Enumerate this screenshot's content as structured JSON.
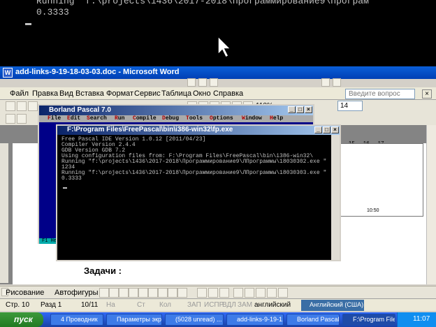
{
  "background_console": {
    "line1": "Running \"f:\\projects\\1436\\2017-2018\\Программирование9\\Програм",
    "line2": "0.3333"
  },
  "word": {
    "title": "add-links-9-19-18-03-03.doc - Microsoft Word",
    "menu": [
      "Файл",
      "Правка",
      "Вид",
      "Вставка",
      "Формат",
      "Сервис",
      "Таблица",
      "Окно",
      "Справка"
    ],
    "help_placeholder": "Введите вопрос",
    "font_size": "14",
    "zoom": "110%",
    "ruler_marks": "· 15 · · 16 · · 17",
    "document_heading": "Задачи :",
    "draw_toolbar": {
      "drawing": "Рисование",
      "autoshapes": "Автофигуры"
    },
    "status": {
      "page": "Стр. 10",
      "section": "Разд 1",
      "pages": "10/11",
      "at": "На",
      "line": "Ст",
      "col": "Кол",
      "rec": "ЗАП",
      "trk": "ИСПР",
      "ext": "ВДЛ",
      "ovr": "ЗАМ",
      "lang": "английский",
      "lang_bar": "Английский (США)"
    }
  },
  "borland": {
    "title": "Borland Pascal 7.0",
    "menu": [
      "File",
      "Edit",
      "Search",
      "Run",
      "Compile",
      "Debug",
      "Tools",
      "Options",
      "Window",
      "Help"
    ],
    "status_key": "F1 He"
  },
  "freepascal": {
    "title": "F:\\Program Files\\FreePascal\\bin\\i386-win32\\fp.exe",
    "lines": [
      "Free Pascal IDE Version 1.0.12 [2011/04/23]",
      "Compiler Version 2.4.4",
      "GDB Version GDB 7.2",
      "Using configuration files from: F:\\Program Files\\FreePascal\\bin\\i386-win32\\",
      "Running \"f:\\projects\\1436\\2017-2018\\Программирование9\\ЛПрограммы\\18030302.exe \"",
      "1234",
      "Running \"f:\\projects\\1436\\2017-2018\\Программирование9\\ЛПрограммы\\18030303.exe \"",
      "0.3333"
    ]
  },
  "right_dialog": {
    "value": "10:50"
  },
  "taskbar": {
    "start": "пуск",
    "tasks": [
      "4 Проводник",
      "Параметры экр...",
      "(5028 unread) ...",
      "add-links-9-19-1...",
      "Borland Pascal 7.0",
      "F:\\Program Files..."
    ],
    "clock": "11:07"
  }
}
